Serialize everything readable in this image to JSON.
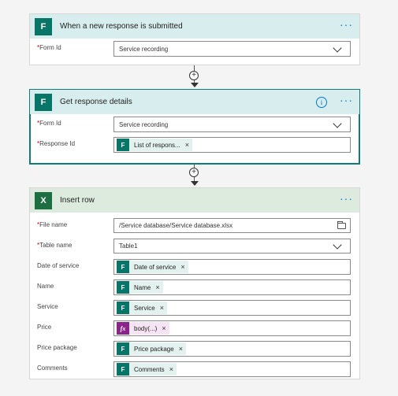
{
  "trigger": {
    "title": "When a new response is submitted",
    "icon": "forms-icon",
    "fields": [
      {
        "label": "Form Id",
        "required": true,
        "value": "Service recording",
        "type": "dropdown"
      }
    ]
  },
  "get_details": {
    "title": "Get response details",
    "icon": "forms-icon",
    "info_glyph": "i",
    "fields": [
      {
        "label": "Form Id",
        "required": true,
        "value": "Service recording",
        "type": "dropdown"
      },
      {
        "label": "Response Id",
        "required": true,
        "token": "List of respons...",
        "type": "token"
      }
    ]
  },
  "insert_row": {
    "title": "Insert row",
    "icon": "excel-icon",
    "fields": [
      {
        "label": "File name",
        "required": true,
        "value": "/Service database/Service database.xlsx",
        "type": "file"
      },
      {
        "label": "Table name",
        "required": true,
        "value": "Table1",
        "type": "dropdown"
      },
      {
        "label": "Date of service",
        "required": false,
        "token": "Date of service",
        "type": "token"
      },
      {
        "label": "Name",
        "required": false,
        "token": "Name",
        "type": "token"
      },
      {
        "label": "Service",
        "required": false,
        "token": "Service",
        "type": "token"
      },
      {
        "label": "Price",
        "required": false,
        "token": "body(...)",
        "type": "fx"
      },
      {
        "label": "Price package",
        "required": false,
        "token": "Price package",
        "type": "token"
      },
      {
        "label": "Comments",
        "required": false,
        "token": "Comments",
        "type": "token"
      }
    ]
  },
  "glyphs": {
    "more": "···",
    "required_star": "*",
    "remove": "×",
    "add": "+",
    "fx": "fx",
    "forms_letter": "F",
    "excel_letter": "X"
  },
  "colors": {
    "forms": "#077568",
    "excel": "#1d6f42",
    "fx": "#8a2488",
    "accent": "#0078d4"
  }
}
